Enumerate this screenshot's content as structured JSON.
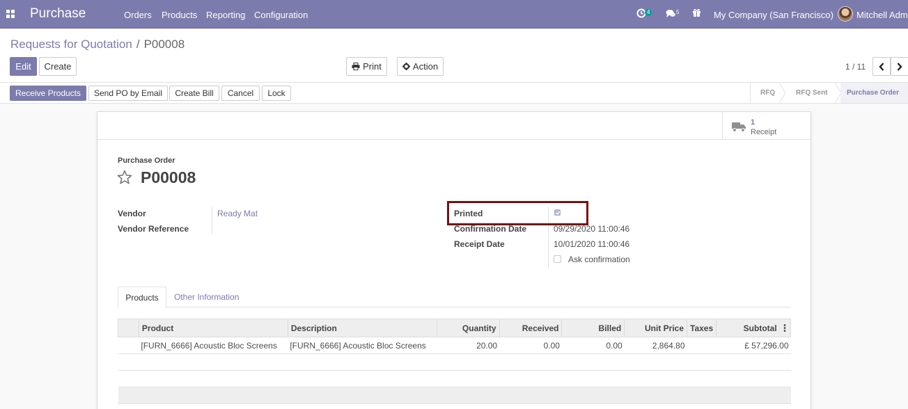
{
  "navbar": {
    "app_title": "Purchase",
    "menus": [
      "Orders",
      "Products",
      "Reporting",
      "Configuration"
    ],
    "activity_count": "4",
    "messages_count": "5",
    "company": "My Company (San Francisco)",
    "user": "Mitchell Admin",
    "icons": [
      "apps-grid-icon",
      "clock-icon",
      "chat-icon",
      "gift-icon"
    ]
  },
  "breadcrumb": {
    "parent": "Requests for Quotation",
    "separator": "/",
    "current": "P00008"
  },
  "toolbar": {
    "edit": "Edit",
    "create": "Create",
    "print": "Print",
    "action": "Action",
    "pager": "1 / 11"
  },
  "statusbar": {
    "buttons": [
      "Receive Products",
      "Send PO by Email",
      "Create Bill",
      "Cancel",
      "Lock"
    ],
    "stages": [
      "RFQ",
      "RFQ Sent",
      "Purchase Order"
    ],
    "active_stage": "Purchase Order"
  },
  "smart_button": {
    "value": "1",
    "label": "Receipt"
  },
  "form": {
    "doc_label": "Purchase Order",
    "name": "P00008",
    "vendor_label": "Vendor",
    "vendor": "Ready Mat",
    "vendor_ref_label": "Vendor Reference",
    "printed_label": "Printed",
    "printed": true,
    "confirmation_label": "Confirmation Date",
    "confirmation_date": "09/29/2020 11:00:46",
    "receipt_label": "Receipt Date",
    "receipt_date": "10/01/2020 11:00:46",
    "ask_confirmation_label": "Ask confirmation",
    "ask_confirmation": false
  },
  "tabs": [
    "Products",
    "Other Information"
  ],
  "lines": {
    "columns": [
      "Product",
      "Description",
      "Quantity",
      "Received",
      "Billed",
      "Unit Price",
      "Taxes",
      "Subtotal"
    ],
    "rows": [
      {
        "product": "[FURN_6666] Acoustic Bloc Screens",
        "description": "[FURN_6666] Acoustic Bloc Screens",
        "quantity": "20.00",
        "received": "0.00",
        "billed": "0.00",
        "unit_price": "2,864.80",
        "taxes": "",
        "subtotal": "£ 57,296.00"
      }
    ]
  },
  "colors": {
    "brand": "#7c7bad",
    "highlight_box": "#7a0d10"
  }
}
